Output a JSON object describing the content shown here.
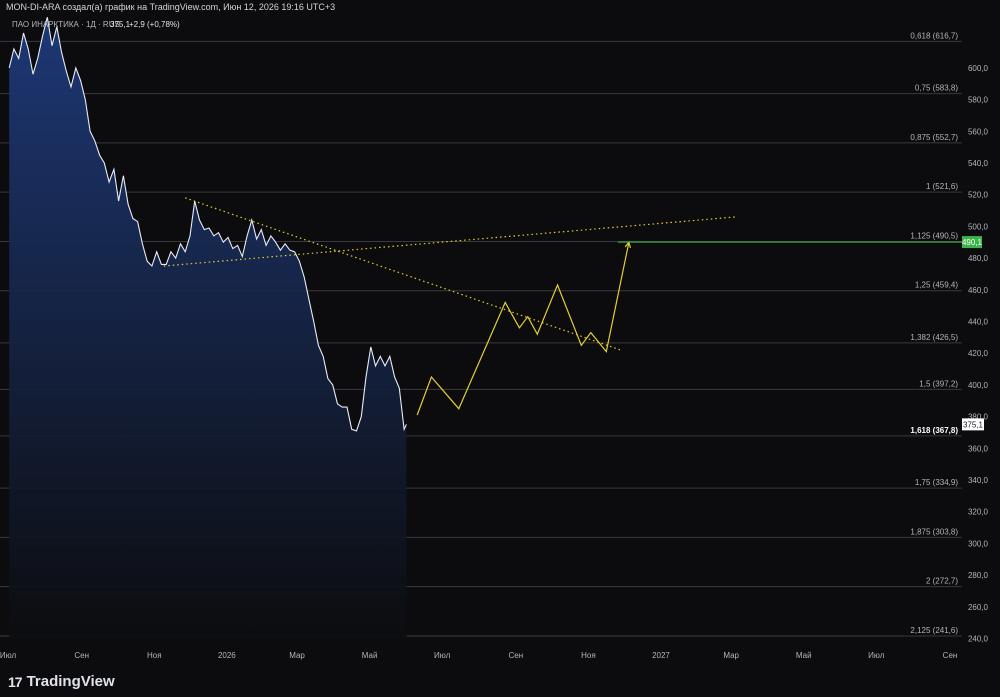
{
  "header": {
    "caption": "MON-DI-ARA создал(а) график на TradingView.com, Июн 12, 2026 19:16 UTC+3"
  },
  "legend": {
    "symbol": "ПАО ИНАРКТИКА · 1Д · RUS",
    "price": "375,1",
    "change": "+2,9 (+0,78%)"
  },
  "footer": {
    "brand": "TradingView"
  },
  "colors": {
    "background": "#0c0c0e",
    "area_line": "#e8ecf5",
    "area_fill_top": "#1e3a7a",
    "fib_line": "#3a3a3e",
    "projection": "#e3cf33",
    "target_line": "#3cb44b",
    "text": "#b2b5be"
  },
  "chart_data": {
    "type": "area",
    "title": "ПАО ИНАРКТИКА · 1Д · RUS",
    "xlabel": "",
    "ylabel": "",
    "ylim": [
      234,
      634
    ],
    "y_ticks": [
      240,
      260,
      280,
      300,
      320,
      340,
      360,
      380,
      400,
      420,
      440,
      460,
      480,
      500,
      520,
      540,
      560,
      580,
      600
    ],
    "y_tick_labels": [
      "240,0",
      "260,0",
      "280,0",
      "300,0",
      "320,0",
      "340,0",
      "360,0",
      "380,0",
      "400,0",
      "420,0",
      "440,0",
      "460,0",
      "480,0",
      "500,0",
      "520,0",
      "540,0",
      "560,0",
      "580,0",
      "600,0"
    ],
    "x_ticks": [
      {
        "label": "Июл",
        "x": "2025-07-01"
      },
      {
        "label": "Сен",
        "x": "2025-09-01"
      },
      {
        "label": "Ноя",
        "x": "2025-11-01"
      },
      {
        "label": "2026",
        "x": "2026-01-01"
      },
      {
        "label": "Мар",
        "x": "2026-03-01"
      },
      {
        "label": "Май",
        "x": "2026-05-01"
      },
      {
        "label": "Июл",
        "x": "2026-07-01"
      },
      {
        "label": "Сен",
        "x": "2026-09-01"
      },
      {
        "label": "Ноя",
        "x": "2026-11-01"
      },
      {
        "label": "2027",
        "x": "2027-01-01"
      },
      {
        "label": "Мар",
        "x": "2027-03-01"
      },
      {
        "label": "Май",
        "x": "2027-05-01"
      },
      {
        "label": "Июл",
        "x": "2027-07-01"
      },
      {
        "label": "Сен",
        "x": "2027-09-01"
      }
    ],
    "series": [
      {
        "points": [
          [
            "2025-07-02",
            600
          ],
          [
            "2025-07-06",
            612
          ],
          [
            "2025-07-10",
            606
          ],
          [
            "2025-07-14",
            622
          ],
          [
            "2025-07-18",
            612
          ],
          [
            "2025-07-22",
            596
          ],
          [
            "2025-07-26",
            606
          ],
          [
            "2025-07-30",
            620
          ],
          [
            "2025-08-03",
            632
          ],
          [
            "2025-08-07",
            614
          ],
          [
            "2025-08-11",
            626
          ],
          [
            "2025-08-15",
            610
          ],
          [
            "2025-08-19",
            598
          ],
          [
            "2025-08-23",
            588
          ],
          [
            "2025-08-27",
            600
          ],
          [
            "2025-08-31",
            592
          ],
          [
            "2025-09-04",
            580
          ],
          [
            "2025-09-08",
            560
          ],
          [
            "2025-09-12",
            554
          ],
          [
            "2025-09-16",
            545
          ],
          [
            "2025-09-20",
            540
          ],
          [
            "2025-09-24",
            528
          ],
          [
            "2025-09-28",
            536
          ],
          [
            "2025-10-02",
            516
          ],
          [
            "2025-10-06",
            532
          ],
          [
            "2025-10-10",
            514
          ],
          [
            "2025-10-14",
            505
          ],
          [
            "2025-10-18",
            503
          ],
          [
            "2025-10-22",
            489
          ],
          [
            "2025-10-26",
            478
          ],
          [
            "2025-10-30",
            475
          ],
          [
            "2025-11-03",
            484
          ],
          [
            "2025-11-07",
            476
          ],
          [
            "2025-11-11",
            476
          ],
          [
            "2025-11-15",
            484
          ],
          [
            "2025-11-19",
            480
          ],
          [
            "2025-11-23",
            489
          ],
          [
            "2025-11-27",
            484
          ],
          [
            "2025-12-01",
            494
          ],
          [
            "2025-12-05",
            516
          ],
          [
            "2025-12-09",
            504
          ],
          [
            "2025-12-13",
            498
          ],
          [
            "2025-12-17",
            499
          ],
          [
            "2025-12-21",
            494
          ],
          [
            "2025-12-25",
            496
          ],
          [
            "2025-12-29",
            490
          ],
          [
            "2026-01-02",
            493
          ],
          [
            "2026-01-06",
            486
          ],
          [
            "2026-01-10",
            488
          ],
          [
            "2026-01-14",
            481
          ],
          [
            "2026-01-18",
            494
          ],
          [
            "2026-01-22",
            504
          ],
          [
            "2026-01-26",
            492
          ],
          [
            "2026-01-30",
            498
          ],
          [
            "2026-02-03",
            488
          ],
          [
            "2026-02-07",
            494
          ],
          [
            "2026-02-11",
            490
          ],
          [
            "2026-02-15",
            485
          ],
          [
            "2026-02-19",
            489
          ],
          [
            "2026-02-23",
            485
          ],
          [
            "2026-02-27",
            484
          ],
          [
            "2026-03-03",
            478
          ],
          [
            "2026-03-07",
            468
          ],
          [
            "2026-03-11",
            454
          ],
          [
            "2026-03-15",
            440
          ],
          [
            "2026-03-19",
            425
          ],
          [
            "2026-03-23",
            418
          ],
          [
            "2026-03-27",
            404
          ],
          [
            "2026-03-31",
            400
          ],
          [
            "2026-04-04",
            388
          ],
          [
            "2026-04-08",
            386
          ],
          [
            "2026-04-12",
            386
          ],
          [
            "2026-04-16",
            372
          ],
          [
            "2026-04-20",
            371
          ],
          [
            "2026-04-24",
            380
          ],
          [
            "2026-04-28",
            405
          ],
          [
            "2026-05-02",
            424
          ],
          [
            "2026-05-06",
            412
          ],
          [
            "2026-05-10",
            418
          ],
          [
            "2026-05-14",
            412
          ],
          [
            "2026-05-18",
            418
          ],
          [
            "2026-05-22",
            405
          ],
          [
            "2026-05-26",
            398
          ],
          [
            "2026-05-30",
            372
          ],
          [
            "2026-06-01",
            375.1
          ]
        ]
      }
    ],
    "fibonacci": [
      {
        "label": "0,618 (616,7)",
        "price": 616.7
      },
      {
        "label": "0,75 (583,8)",
        "price": 583.8
      },
      {
        "label": "0,875 (552,7)",
        "price": 552.7
      },
      {
        "label": "1 (521,6)",
        "price": 521.6
      },
      {
        "label": "1,125 (490,5)",
        "price": 490.5
      },
      {
        "label": "1,25 (459,4)",
        "price": 459.4
      },
      {
        "label": "1,382 (426,5)",
        "price": 426.5
      },
      {
        "label": "1,5 (397,2)",
        "price": 397.2
      },
      {
        "label": "1,618 (367,8)",
        "price": 367.8,
        "emphasized": true
      },
      {
        "label": "1,75 (334,9)",
        "price": 334.9
      },
      {
        "label": "1,875 (303,8)",
        "price": 303.8
      },
      {
        "label": "2 (272,7)",
        "price": 272.7
      },
      {
        "label": "2,125 (241,6)",
        "price": 241.6
      }
    ],
    "trendlines": [
      {
        "from": [
          "2025-11-27",
          518
        ],
        "to": [
          "2026-11-28",
          422
        ]
      },
      {
        "from": [
          "2025-11-09",
          475
        ],
        "to": [
          "2027-03-05",
          506
        ]
      }
    ],
    "projection": [
      [
        "2026-06-10",
        381
      ],
      [
        "2026-06-22",
        405
      ],
      [
        "2026-07-15",
        385
      ],
      [
        "2026-08-23",
        452
      ],
      [
        "2026-09-04",
        436
      ],
      [
        "2026-09-11",
        443
      ],
      [
        "2026-09-19",
        432
      ],
      [
        "2026-10-06",
        463
      ],
      [
        "2026-10-26",
        425
      ],
      [
        "2026-11-03",
        433
      ],
      [
        "2026-11-16",
        421
      ],
      [
        "2026-12-05",
        490
      ]
    ],
    "target": {
      "price": 490.1,
      "label": "490,1"
    },
    "current_price": {
      "price": 375.1,
      "label": "375,1"
    }
  }
}
